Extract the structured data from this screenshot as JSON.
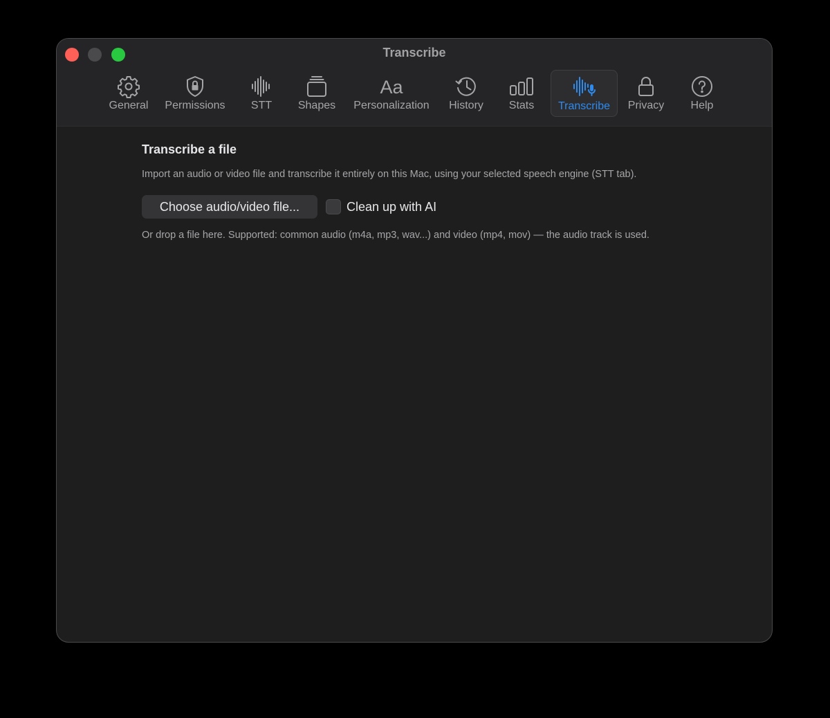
{
  "window": {
    "title": "Transcribe"
  },
  "toolbar": {
    "tabs": [
      {
        "label": "General",
        "icon": "gear-icon"
      },
      {
        "label": "Permissions",
        "icon": "shield-lock-icon"
      },
      {
        "label": "STT",
        "icon": "waveform-icon"
      },
      {
        "label": "Shapes",
        "icon": "stack-icon"
      },
      {
        "label": "Personalization",
        "icon": "text-format-icon"
      },
      {
        "label": "History",
        "icon": "history-clock-icon"
      },
      {
        "label": "Stats",
        "icon": "bar-chart-icon"
      },
      {
        "label": "Transcribe",
        "icon": "waveform-mic-icon",
        "selected": true
      },
      {
        "label": "Privacy",
        "icon": "lock-icon"
      },
      {
        "label": "Help",
        "icon": "question-circle-icon"
      }
    ],
    "selected_color": "#2d8bf0",
    "icon_color": "#a5a5a7"
  },
  "main": {
    "section_title": "Transcribe a file",
    "description": "Import an audio or video file and transcribe it entirely on this Mac, using your selected speech engine (STT tab).",
    "choose_button_label": "Choose audio/video file...",
    "cleanup_checkbox_label": "Clean up with AI",
    "cleanup_checked": false,
    "hint": "Or drop a file here. Supported: common audio (m4a, mp3, wav...) and video (mp4, mov) — the audio track is used."
  }
}
